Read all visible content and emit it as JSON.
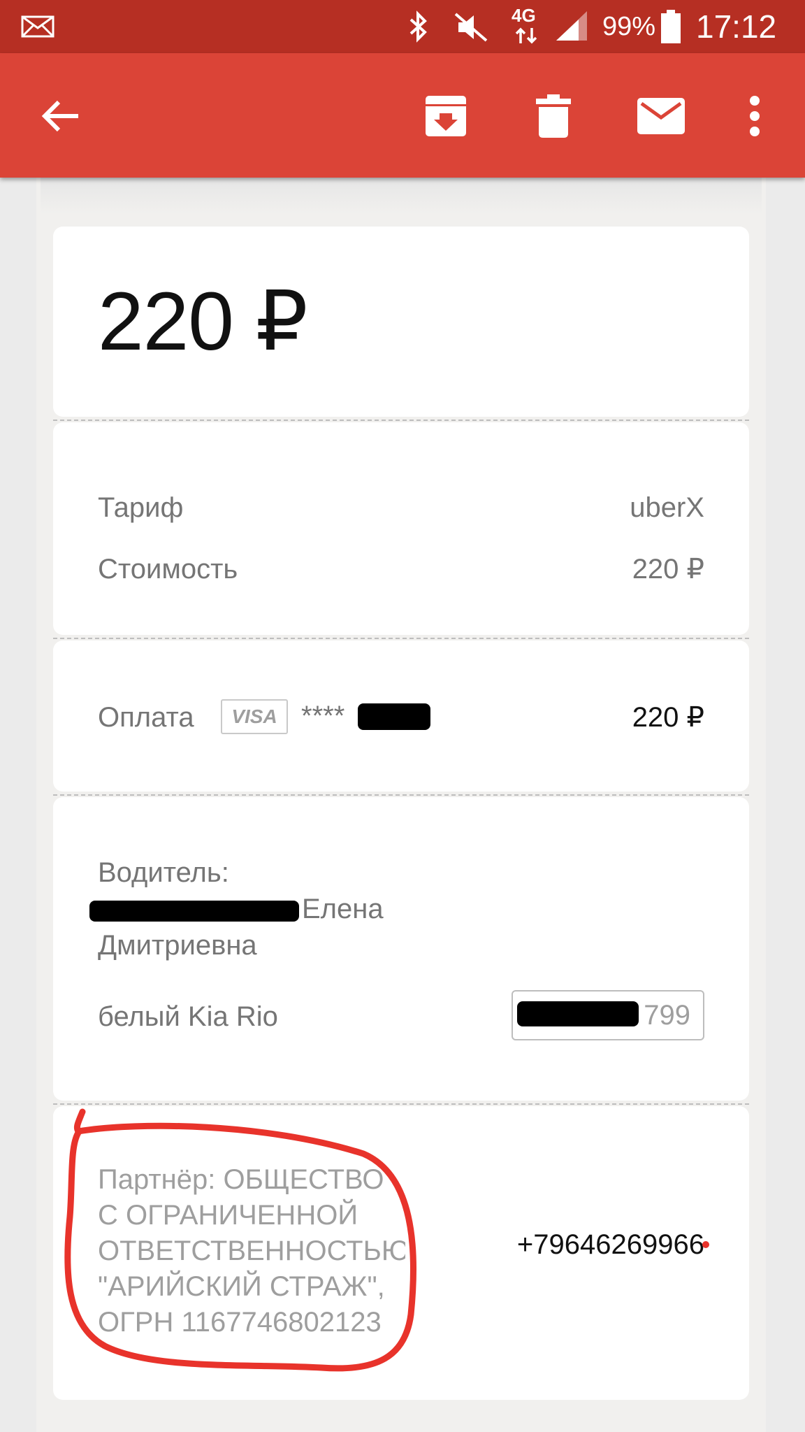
{
  "status_bar": {
    "battery": "99%",
    "time": "17:12",
    "network": "4G"
  },
  "app_bar": {
    "back_icon": "arrow-left-icon",
    "actions": [
      "archive-icon",
      "delete-icon",
      "mark-unread-icon",
      "more-vert-icon"
    ]
  },
  "receipt": {
    "total": "220 ₽",
    "tariff_label": "Тариф",
    "tariff_value": "uberX",
    "cost_label": "Стоимость",
    "cost_value": "220 ₽",
    "payment_label": "Оплата",
    "card_brand": "VISA",
    "card_masked": "****",
    "payment_amount": "220 ₽",
    "driver_label": "Водитель:",
    "driver_name_visible": "Елена",
    "driver_patronymic": "Дмитриевна",
    "car": "белый Kia Rio",
    "plate_visible": "799",
    "partner_lines": [
      "Партнёр: ОБЩЕСТВО",
      "С ОГРАНИЧЕННОЙ",
      "ОТВЕТСТВЕННОСТЬЮ",
      "\"АРИЙСКИЙ СТРАЖ\",",
      "ОГРН 1167746802123"
    ],
    "partner_phone": "+79646269966"
  },
  "colors": {
    "status_bar": "#b62f23",
    "app_bar": "#db4437",
    "annotation": "#e8332b"
  }
}
